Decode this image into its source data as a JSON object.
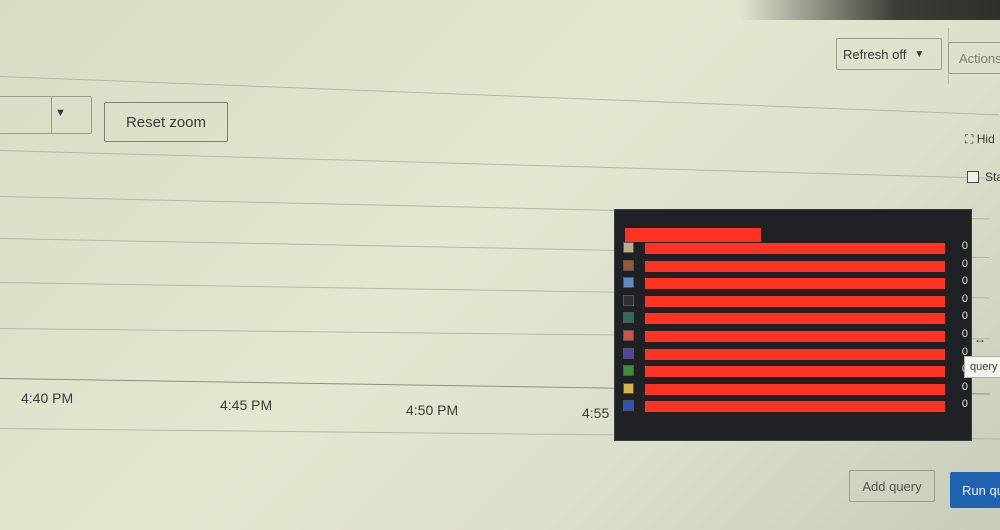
{
  "toolbar": {
    "refresh_label": "Refresh off",
    "actions_label": "Actions"
  },
  "zoom": {
    "selected_value": "",
    "reset_label": "Reset zoom"
  },
  "graph_controls": {
    "hide_graph_label": "Hid",
    "stacked_label": "Sta"
  },
  "x_axis": {
    "ticks": [
      "4:40 PM",
      "4:45 PM",
      "4:50 PM",
      "4:55"
    ]
  },
  "tooltip": {
    "title_redacted": true,
    "rows": [
      {
        "color": "#b9b08a",
        "value": "0"
      },
      {
        "color": "#9a5a3a",
        "value": "0"
      },
      {
        "color": "#5a8fc6",
        "value": "0"
      },
      {
        "color": "#2e3033",
        "value": "0"
      },
      {
        "color": "#2e6e5a",
        "value": "0"
      },
      {
        "color": "#d0523f",
        "value": "0"
      },
      {
        "color": "#4b47a8",
        "value": "0"
      },
      {
        "color": "#3e8f3c",
        "value": "0"
      },
      {
        "color": "#d9b24a",
        "value": "0"
      },
      {
        "color": "#2c55b8",
        "value": "0"
      }
    ],
    "redaction_color": "#ff3322"
  },
  "hover_tag": "query",
  "footer": {
    "add_query_label": "Add query",
    "run_query_label": "Run qu"
  },
  "colors": {
    "primary": "#1f63b0",
    "tooltip_bg": "#1f2124"
  }
}
